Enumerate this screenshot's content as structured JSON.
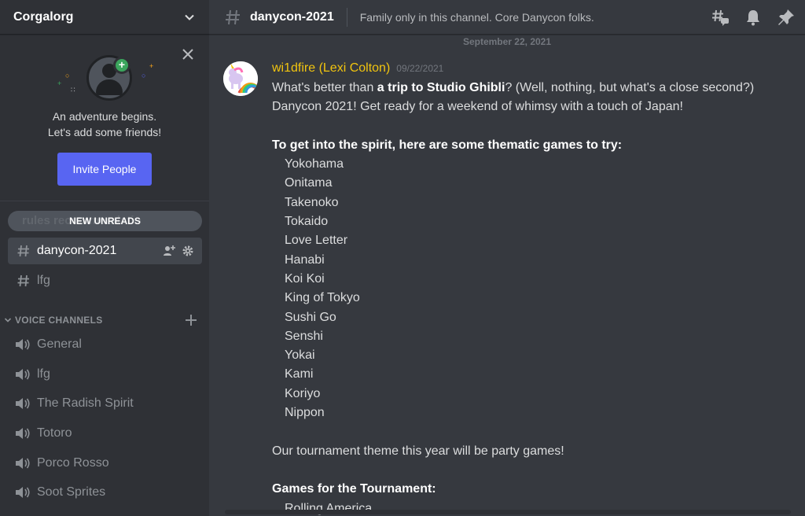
{
  "server": {
    "name": "Corgalorg"
  },
  "invite_card": {
    "line1": "An adventure begins.",
    "line2": "Let's add some friends!",
    "button": "Invite People"
  },
  "unreads": {
    "label": "NEW UNREADS",
    "ghost": "rules  recommendatio"
  },
  "text_channels": [
    {
      "name": "danycon-2021",
      "active": true
    },
    {
      "name": "lfg",
      "active": false
    }
  ],
  "voice_category": {
    "label": "VOICE CHANNELS"
  },
  "voice_channels": [
    {
      "name": "General"
    },
    {
      "name": "lfg"
    },
    {
      "name": "The Radish Spirit"
    },
    {
      "name": "Totoro"
    },
    {
      "name": "Porco Rosso"
    },
    {
      "name": "Soot Sprites"
    }
  ],
  "topbar": {
    "channel": "danycon-2021",
    "topic": "Family only in this channel. Core Danycon folks."
  },
  "date_divider": "September 22, 2021",
  "message": {
    "author": "wi1dfire (Lexi Colton)",
    "timestamp": "09/22/2021",
    "line1_pre": "What's better than ",
    "line1_bold": "a trip to Studio Ghibli",
    "line1_post": "?  (Well, nothing, but what's a close second?)",
    "line2": "Danycon 2021!  Get ready for a weekend of whimsy with a touch of Japan!",
    "games_heading": "To get into the spirit, here are some thematic games to try:",
    "games": [
      "Yokohama",
      "Onitama",
      "Takenoko",
      "Tokaido",
      "Love Letter",
      "Hanabi",
      "Koi Koi",
      "King of Tokyo",
      "Sushi Go",
      "Senshi",
      "Yokai",
      "Kami",
      "Koriyo",
      "Nippon"
    ],
    "tournament_line": "Our tournament theme this year will be party games!",
    "tournament_heading": "Games for the Tournament:",
    "cut_line": "Rolling America"
  },
  "colors": {
    "sidebar_bg": "#2f3136",
    "main_bg": "#36393f",
    "accent": "#5865f2",
    "author": "#f1c40f",
    "online_green": "#3ba55d"
  },
  "icons": [
    "chevron-down-icon",
    "close-icon",
    "hash-icon",
    "add-member-icon",
    "gear-icon",
    "plus-icon",
    "speaker-icon",
    "threads-icon",
    "bell-icon",
    "pin-icon"
  ]
}
